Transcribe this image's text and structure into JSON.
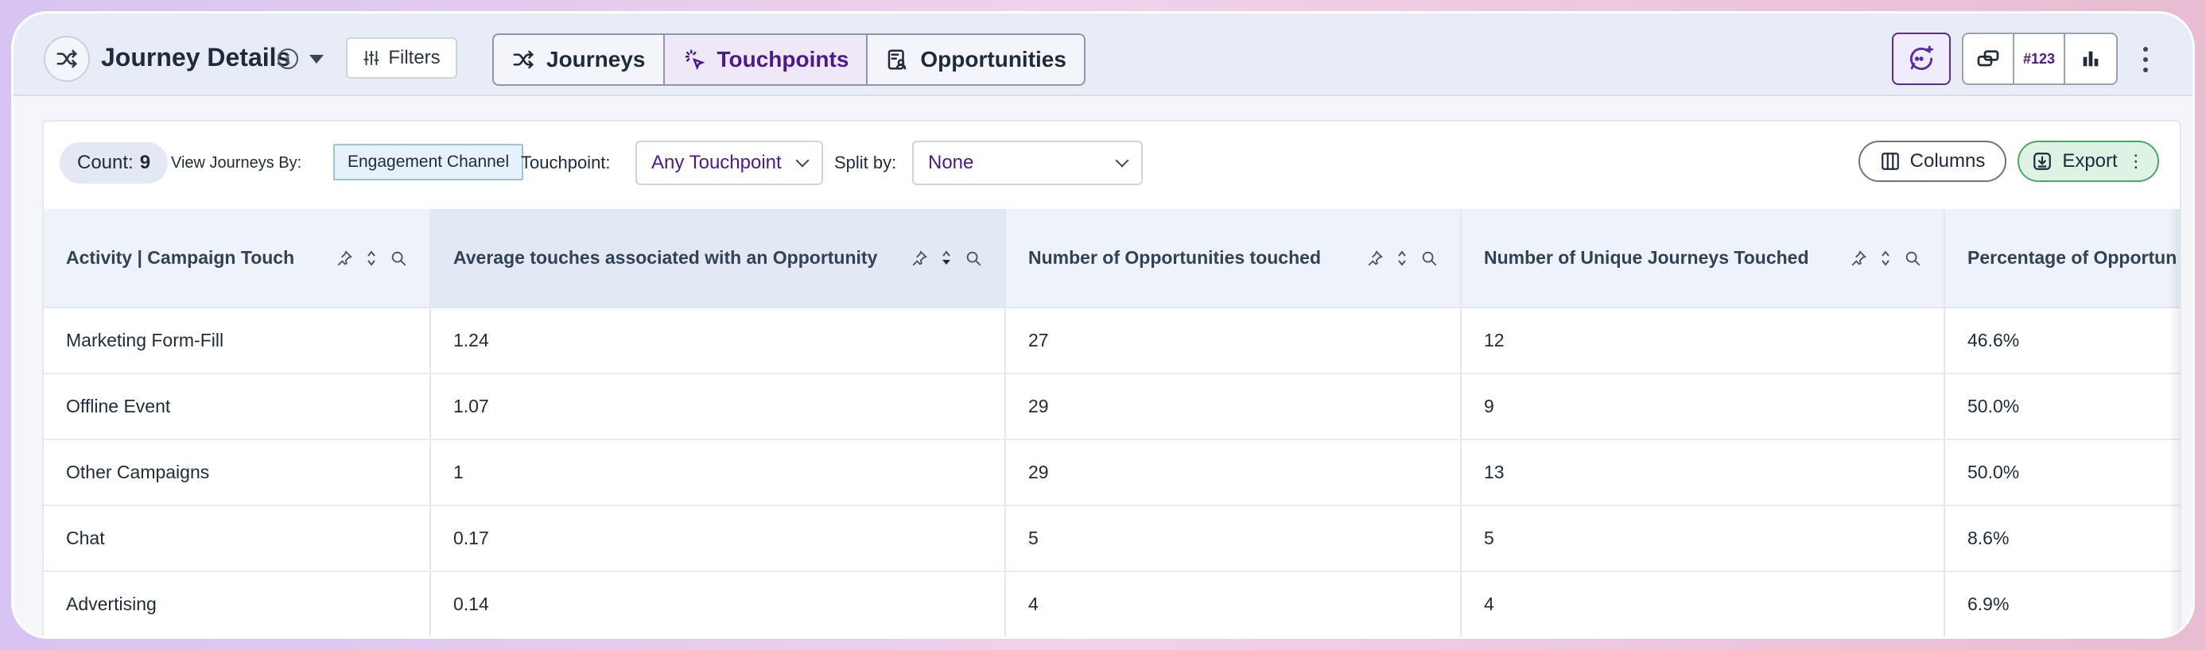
{
  "header": {
    "title": "Journey Details",
    "filters_label": "Filters",
    "tabs": [
      {
        "label": "Journeys",
        "icon": "shuffle-icon"
      },
      {
        "label": "Touchpoints",
        "icon": "cursor-click-icon",
        "active": true
      },
      {
        "label": "Opportunities",
        "icon": "contact-card-icon"
      }
    ],
    "tools": {
      "number_label": "#123"
    }
  },
  "toolbar": {
    "count_label": "Count:",
    "count_value": "9",
    "view_by_label": "View Journeys By:",
    "view_by_value": "Engagement Channel",
    "touchpoint_label": "Touchpoint:",
    "touchpoint_value": "Any Touchpoint",
    "split_label": "Split by:",
    "split_value": "None",
    "columns_label": "Columns",
    "export_label": "Export"
  },
  "table": {
    "columns": [
      "Activity | Campaign Touch",
      "Average touches associated with an Opportunity",
      "Number of Opportunities touched",
      "Number of Unique Journeys Touched",
      "Percentage of Opportun"
    ],
    "rows": [
      [
        "Marketing Form-Fill",
        "1.24",
        "27",
        "12",
        "46.6%"
      ],
      [
        "Offline Event",
        "1.07",
        "29",
        "9",
        "50.0%"
      ],
      [
        "Other Campaigns",
        "1",
        "29",
        "13",
        "50.0%"
      ],
      [
        "Chat",
        "0.17",
        "5",
        "5",
        "8.6%"
      ],
      [
        "Advertising",
        "0.14",
        "4",
        "4",
        "6.9%"
      ]
    ]
  },
  "colors": {
    "accent": "#4b1b8c",
    "export_green": "#4aa66a",
    "header_bg": "#e7ecf6"
  }
}
